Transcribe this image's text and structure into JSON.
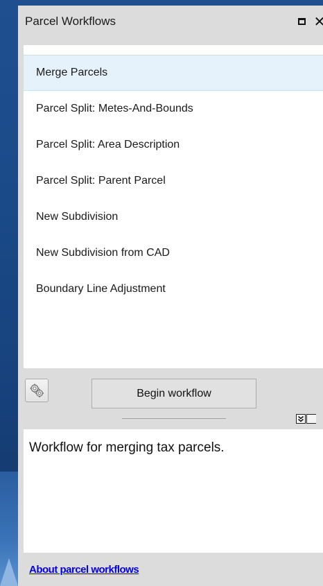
{
  "window": {
    "title": "Parcel Workflows",
    "close_glyph": "✕"
  },
  "workflows": {
    "selected_index": 0,
    "items": [
      {
        "label": "Merge Parcels"
      },
      {
        "label": "Parcel Split: Metes-And-Bounds"
      },
      {
        "label": "Parcel Split: Area Description"
      },
      {
        "label": "Parcel Split: Parent Parcel"
      },
      {
        "label": "New Subdivision"
      },
      {
        "label": "New Subdivision from CAD"
      },
      {
        "label": "Boundary Line Adjustment"
      }
    ]
  },
  "toolbar": {
    "options_icon": "gears-icon",
    "begin_label": "Begin workflow"
  },
  "description": {
    "text": "Workflow for merging tax parcels."
  },
  "footer": {
    "about_link": "About parcel workflows"
  },
  "colors": {
    "selection_bg": "#e5f1fb",
    "link": "#0000e0",
    "panel_bg": "#dcdcdc"
  }
}
